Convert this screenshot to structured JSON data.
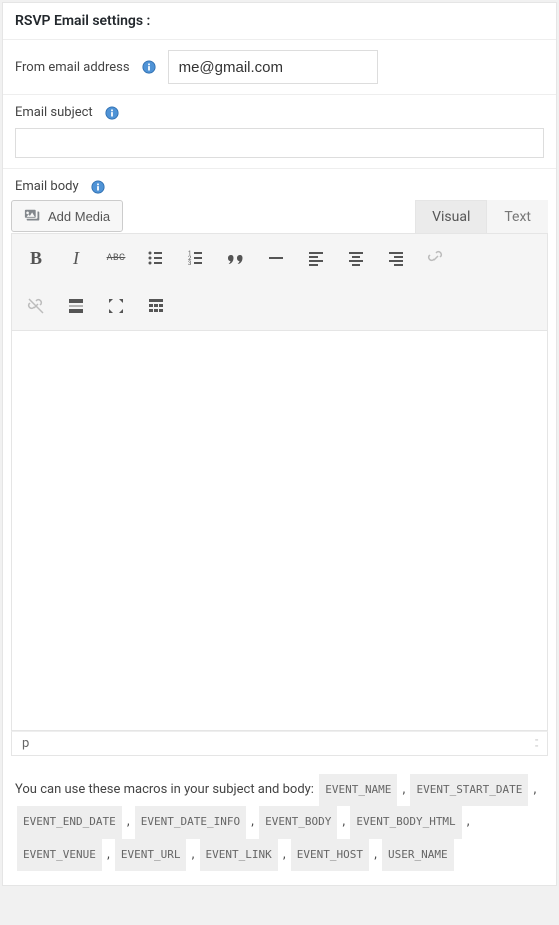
{
  "heading": "RSVP Email settings :",
  "from": {
    "label": "From email address",
    "value": "me@gmail.com"
  },
  "subject": {
    "label": "Email subject",
    "value": ""
  },
  "body": {
    "label": "Email body",
    "add_media": "Add Media",
    "tabs": {
      "visual": "Visual",
      "text": "Text"
    },
    "status_path": "p"
  },
  "macros": {
    "intro": "You can use these macros in your subject and body:",
    "list": [
      "EVENT_NAME",
      "EVENT_START_DATE",
      "EVENT_END_DATE",
      "EVENT_DATE_INFO",
      "EVENT_BODY",
      "EVENT_BODY_HTML",
      "EVENT_VENUE",
      "EVENT_URL",
      "EVENT_LINK",
      "EVENT_HOST",
      "USER_NAME"
    ]
  }
}
